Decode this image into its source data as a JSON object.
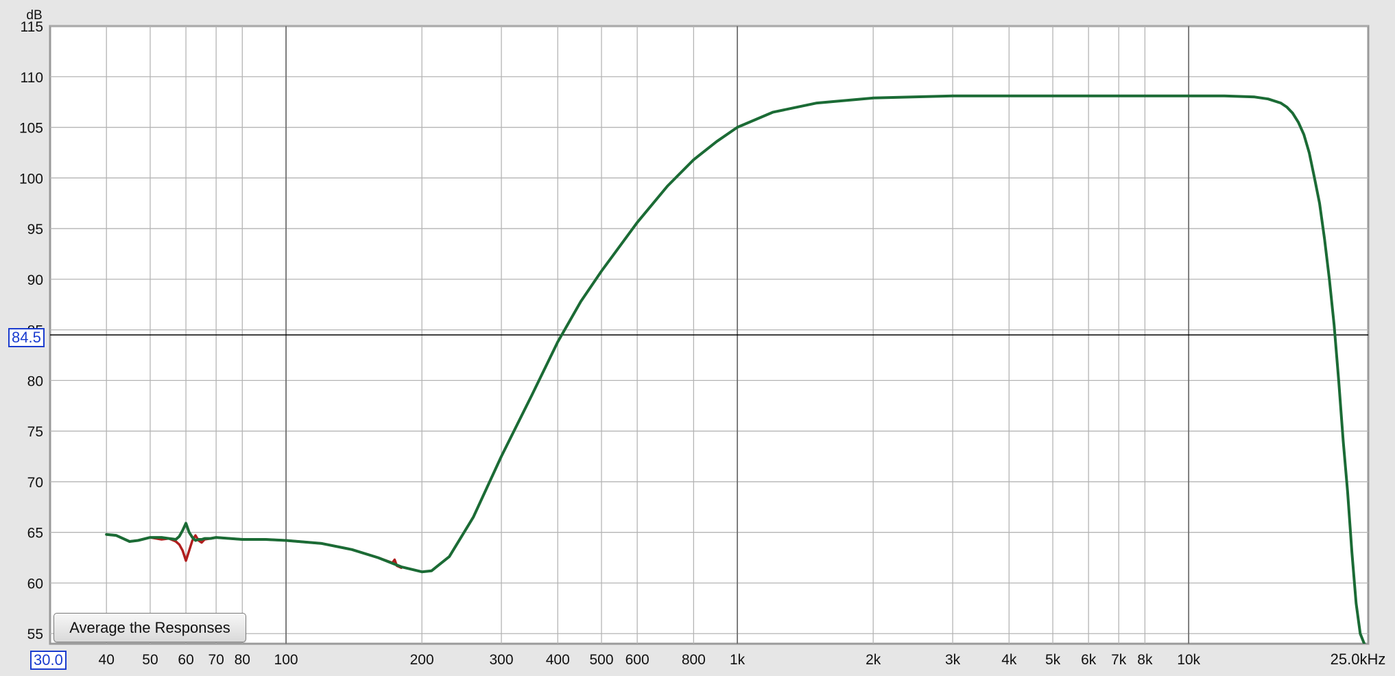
{
  "chart_data": {
    "type": "line",
    "ylabel": "dB",
    "xunit": "kHz",
    "xscale": "log",
    "xlim": [
      30,
      25000
    ],
    "ylim": [
      54,
      115
    ],
    "xticks": [
      40,
      50,
      60,
      70,
      80,
      100,
      200,
      300,
      400,
      500,
      600,
      800,
      1000,
      2000,
      3000,
      4000,
      5000,
      6000,
      7000,
      8000,
      10000
    ],
    "xtick_labels": [
      "40",
      "50",
      "60",
      "70",
      "80",
      "100",
      "200",
      "300",
      "400",
      "500",
      "600",
      "800",
      "1k",
      "2k",
      "3k",
      "4k",
      "5k",
      "6k",
      "7k",
      "8k",
      "10k"
    ],
    "xlim_max_label": "25.0kHz",
    "yticks": [
      55,
      60,
      65,
      70,
      75,
      80,
      85,
      90,
      95,
      100,
      105,
      110,
      115
    ],
    "ytick_labels": [
      "55",
      "60",
      "65",
      "70",
      "75",
      "80",
      "85",
      "90",
      "95",
      "100",
      "105",
      "110",
      "115"
    ],
    "cursor_y": 84.5,
    "cursor_y_label": "84.5",
    "xlim_min_label": "30.0",
    "grid": true,
    "series": [
      {
        "color": "#b01e1e",
        "x": [
          40,
          42,
          45,
          47,
          50,
          53,
          55,
          57,
          58,
          59,
          60,
          61,
          62,
          63,
          64,
          65,
          66,
          68,
          70,
          75,
          80,
          90,
          100,
          120,
          140,
          160,
          172,
          174,
          176,
          180
        ],
        "y": [
          64.8,
          64.7,
          64.1,
          64.2,
          64.5,
          64.3,
          64.4,
          64.1,
          63.8,
          63.2,
          62.2,
          63.2,
          64.2,
          64.7,
          64.2,
          64.0,
          64.3,
          64.4,
          64.5,
          64.4,
          64.3,
          64.3,
          64.2,
          63.9,
          63.3,
          62.5,
          62.0,
          62.3,
          61.7,
          61.5
        ]
      },
      {
        "color": "#1b6b35",
        "x": [
          40,
          42,
          45,
          47,
          50,
          53,
          55,
          57,
          58,
          59,
          60,
          61,
          62,
          63,
          64,
          65,
          66,
          68,
          70,
          75,
          80,
          90,
          100,
          120,
          140,
          160,
          180,
          200,
          210,
          230,
          260,
          300,
          350,
          400,
          450,
          500,
          600,
          700,
          800,
          900,
          1000,
          1200,
          1500,
          2000,
          3000,
          4000,
          5000,
          7000,
          10000,
          12000,
          14000,
          15000,
          16000,
          16500,
          17000,
          17500,
          18000,
          18500,
          19000,
          19500,
          20000,
          20500,
          21000,
          21500,
          22000,
          22500,
          23000,
          23500,
          24000,
          24500,
          25000
        ],
        "y": [
          64.8,
          64.7,
          64.1,
          64.2,
          64.5,
          64.5,
          64.4,
          64.3,
          64.6,
          65.2,
          65.9,
          65.0,
          64.5,
          64.2,
          64.3,
          64.3,
          64.4,
          64.4,
          64.5,
          64.4,
          64.3,
          64.3,
          64.2,
          63.9,
          63.3,
          62.5,
          61.6,
          61.1,
          61.2,
          62.6,
          66.5,
          72.5,
          78.5,
          83.8,
          87.8,
          90.8,
          95.6,
          99.2,
          101.8,
          103.6,
          105.0,
          106.5,
          107.4,
          107.9,
          108.1,
          108.1,
          108.1,
          108.1,
          108.1,
          108.1,
          108.0,
          107.8,
          107.4,
          107.0,
          106.4,
          105.5,
          104.3,
          102.5,
          100.0,
          97.5,
          94.0,
          90.0,
          85.5,
          80.0,
          74.0,
          69.0,
          63.0,
          58.0,
          55.0,
          54.0,
          53.0
        ]
      }
    ]
  },
  "button": {
    "average_label": "Average the Responses"
  }
}
